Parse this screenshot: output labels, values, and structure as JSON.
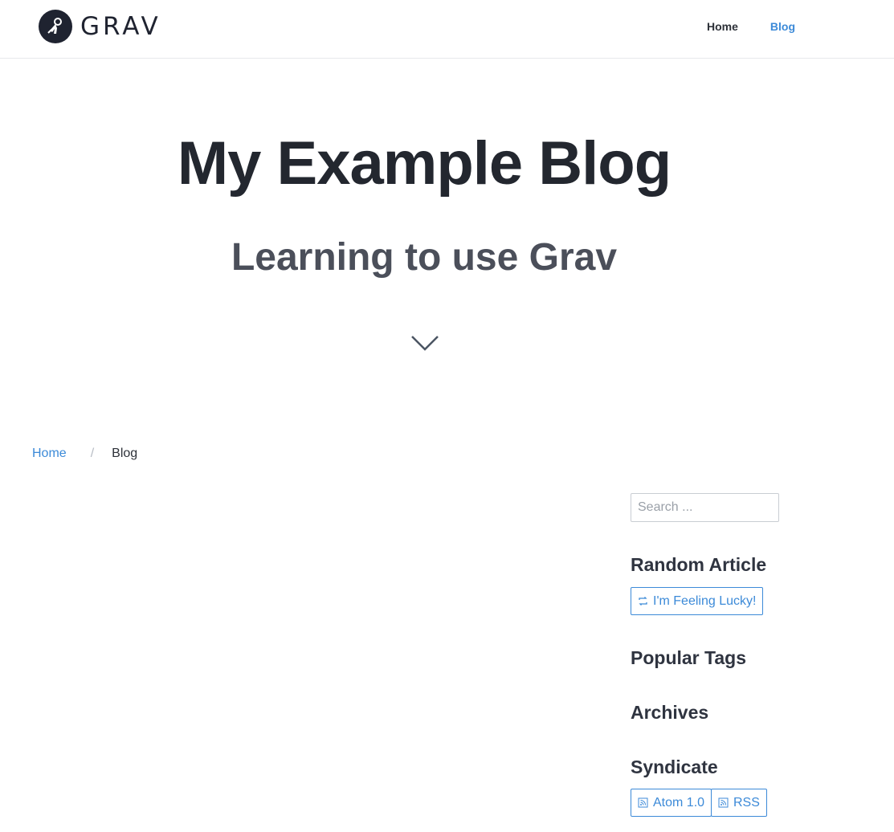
{
  "header": {
    "logo_text": "GRAV",
    "nav": [
      {
        "label": "Home",
        "active": false
      },
      {
        "label": "Blog",
        "active": true
      }
    ]
  },
  "hero": {
    "title": "My Example Blog",
    "subtitle": "Learning to use Grav"
  },
  "breadcrumb": {
    "home": "Home",
    "separator": "/",
    "current": "Blog"
  },
  "sidebar": {
    "search_placeholder": "Search ...",
    "random_heading": "Random Article",
    "lucky_button": "I'm Feeling Lucky!",
    "tags_heading": "Popular Tags",
    "archives_heading": "Archives",
    "syndicate_heading": "Syndicate",
    "atom_button": "Atom 1.0",
    "rss_button": "RSS"
  },
  "colors": {
    "accent": "#3c8ad8",
    "text": "#23272f",
    "border": "#e7e9ec"
  }
}
